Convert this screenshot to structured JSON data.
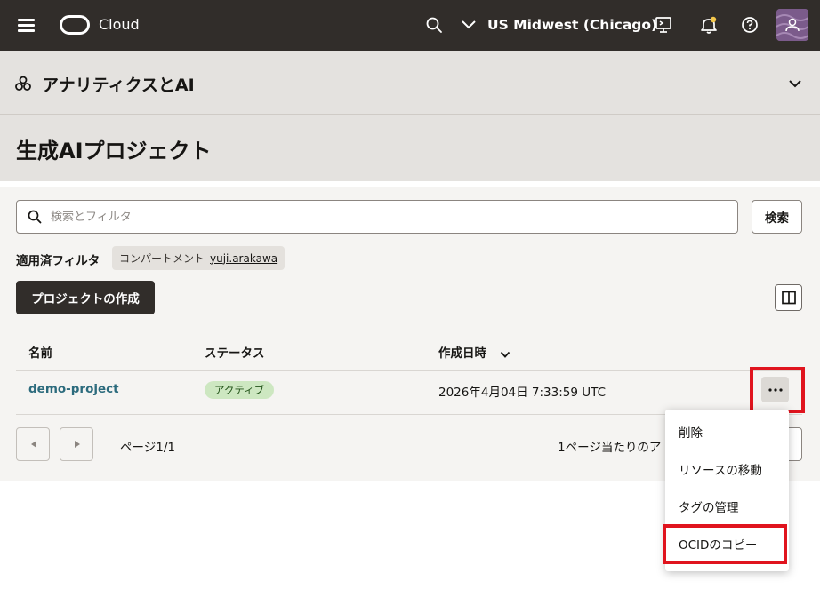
{
  "topbar": {
    "brand": "Cloud",
    "region": "US Midwest (Chicago)",
    "icons": [
      "menu-icon",
      "oracle-logo",
      "search-icon",
      "chevron-down-icon",
      "cloud-shell-icon",
      "bell-icon",
      "help-icon",
      "user-avatar"
    ]
  },
  "section": {
    "title": "アナリティクスとAI",
    "icon": "analytics-icon"
  },
  "page": {
    "title": "生成AIプロジェクト"
  },
  "search": {
    "placeholder": "検索とフィルタ",
    "button_label": "検索"
  },
  "filters": {
    "label": "適用済フィルタ",
    "chip_key": "コンパートメント",
    "chip_value": "yuji.arakawa"
  },
  "actions": {
    "create_label": "プロジェクトの作成"
  },
  "table": {
    "columns": [
      "名前",
      "ステータス",
      "作成日時"
    ],
    "sorted_column": "作成日時",
    "rows": [
      {
        "name": "demo-project",
        "status": "アクティブ",
        "created": "2026年4月04日 7:33:59 UTC"
      }
    ]
  },
  "pagination": {
    "page_text": "ページ1/1",
    "page_size_label": "1ページ当たりのア"
  },
  "row_menu": {
    "items": [
      "削除",
      "リソースの移動",
      "タグの管理",
      "OCIDのコピー"
    ]
  },
  "colors": {
    "topbar_bg": "#312d2a",
    "header_bg": "#e4e2df",
    "content_bg": "#f5f4f2",
    "link": "#2c6b7d",
    "status_bg": "#cde7c1",
    "highlight": "#e0141e"
  }
}
